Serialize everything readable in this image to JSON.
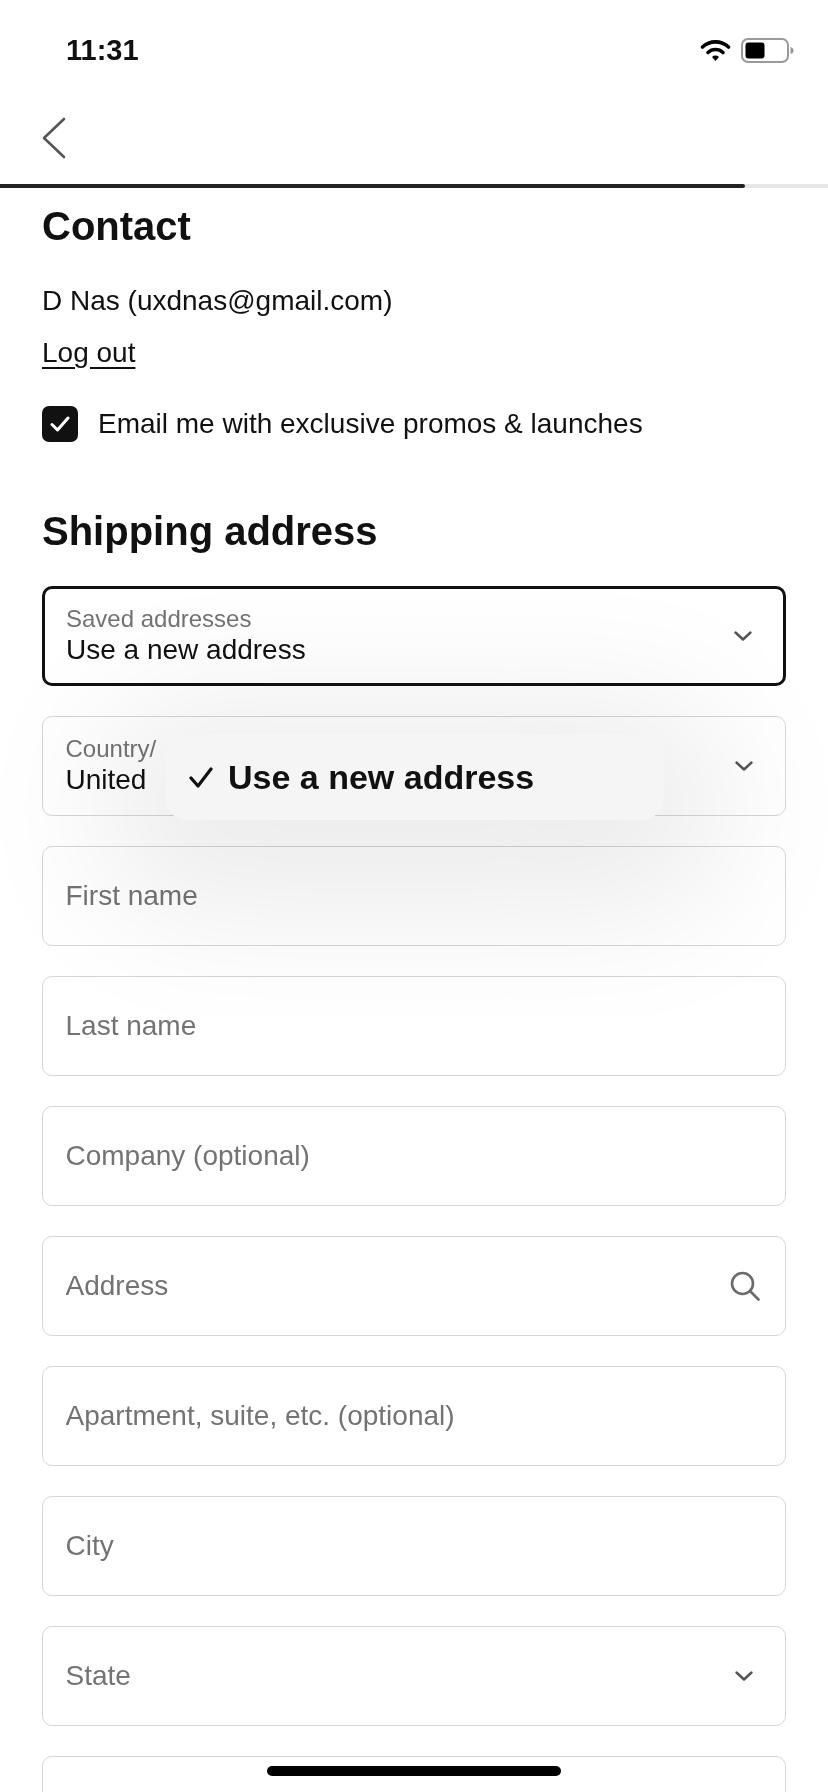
{
  "status_bar": {
    "time": "11:31"
  },
  "nav": {
    "progress": {
      "level": 0.9
    }
  },
  "contact": {
    "title": "Contact",
    "account": "D Nas (uxdnas@gmail.com)",
    "logout_link": "Log out",
    "email_opt_in": {
      "label": "Email me with exclusive promos & launches",
      "checked": true
    }
  },
  "shipping": {
    "title": "Shipping address",
    "fields": [
      {
        "kind": "select",
        "label": "Saved addresses",
        "value": "Use a new address",
        "focused": true
      },
      {
        "kind": "select",
        "label": "Country/",
        "value": "United",
        "focused": false
      },
      {
        "kind": "text",
        "placeholder": "First name",
        "focused": false
      },
      {
        "kind": "text",
        "placeholder": "Last name",
        "focused": false
      },
      {
        "kind": "text",
        "placeholder": "Company (optional)",
        "focused": false
      },
      {
        "kind": "search",
        "placeholder": "Address",
        "focused": false
      },
      {
        "kind": "text",
        "placeholder": "Apartment, suite, etc. (optional)",
        "focused": false
      },
      {
        "kind": "text",
        "placeholder": "City",
        "focused": false
      },
      {
        "kind": "select",
        "placeholder": "State",
        "focused": false
      },
      {
        "kind": "text",
        "focused": false
      }
    ],
    "address_menu": {
      "options": [
        {
          "label": "Use a new address",
          "selected": true
        }
      ]
    }
  }
}
